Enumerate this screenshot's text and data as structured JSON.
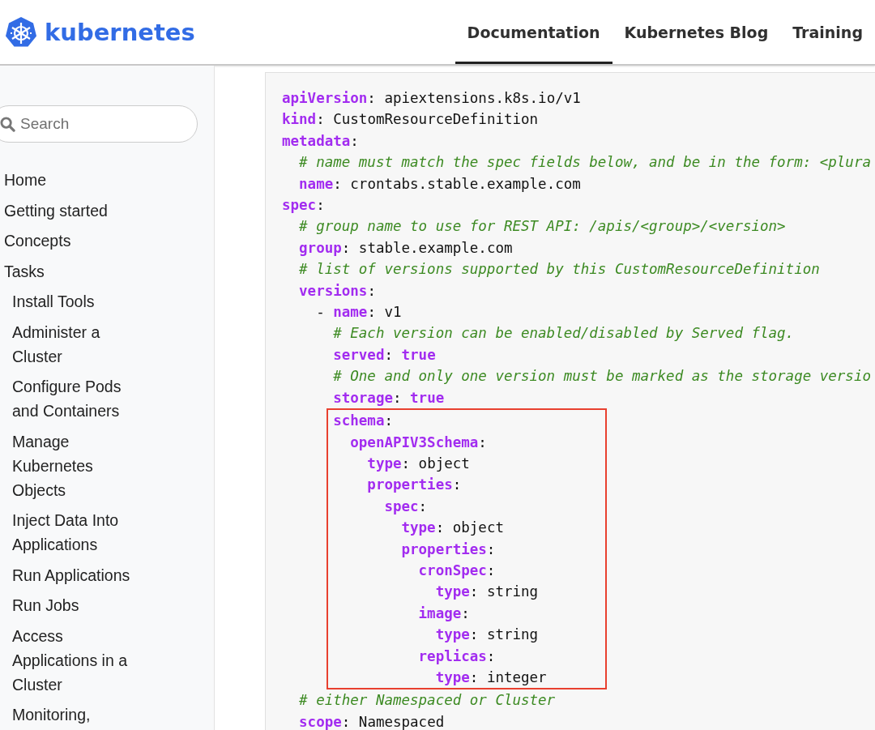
{
  "header": {
    "logo": "kubernetes",
    "nav": [
      {
        "label": "Documentation",
        "selected": true
      },
      {
        "label": "Kubernetes Blog",
        "selected": false
      },
      {
        "label": "Training",
        "selected": false
      }
    ]
  },
  "sidebar": {
    "search": {
      "placeholder": "Search"
    },
    "items": [
      {
        "label": "Home"
      },
      {
        "label": "Getting started"
      },
      {
        "label": "Concepts"
      },
      {
        "label": "Tasks",
        "children": [
          {
            "label": "Install Tools"
          },
          {
            "label": "Administer a Cluster"
          },
          {
            "label": "Configure Pods and Containers"
          },
          {
            "label": "Manage Kubernetes Objects"
          },
          {
            "label": "Inject Data Into Applications"
          },
          {
            "label": "Run Applications"
          },
          {
            "label": "Run Jobs"
          },
          {
            "label": "Access Applications in a Cluster"
          },
          {
            "label": "Monitoring,"
          }
        ]
      }
    ]
  },
  "code": {
    "lines": [
      {
        "kind": "pair",
        "key": "apiVersion",
        "sep": ":",
        "value": "apiextensions.k8s.io/v1"
      },
      {
        "kind": "pair",
        "key": "kind",
        "sep": ":",
        "value": "CustomResourceDefinition"
      },
      {
        "kind": "pair",
        "key": "metadata",
        "sep": ":"
      },
      {
        "kind": "comment",
        "text": "  # name must match the spec fields below, and be in the form: <plura"
      },
      {
        "kind": "pair",
        "key": "  name",
        "sep": ":",
        "value": "crontabs.stable.example.com"
      },
      {
        "kind": "pair",
        "key": "spec",
        "sep": ":"
      },
      {
        "kind": "comment",
        "text": "  # group name to use for REST API: /apis/<group>/<version>"
      },
      {
        "kind": "pair",
        "key": "  group",
        "sep": ":",
        "value": "stable.example.com"
      },
      {
        "kind": "comment",
        "text": "  # list of versions supported by this CustomResourceDefinition"
      },
      {
        "kind": "pair",
        "key": "  versions",
        "sep": ":"
      },
      {
        "kind": "item",
        "dash": "    - ",
        "key": "name",
        "sep": ":",
        "value": "v1"
      },
      {
        "kind": "comment",
        "text": "      # Each version can be enabled/disabled by Served flag."
      },
      {
        "kind": "pair",
        "key": "      served",
        "sep": ":",
        "value": "true",
        "literal": true
      },
      {
        "kind": "comment",
        "text": "      # One and only one version must be marked as the storage versio"
      },
      {
        "kind": "pair",
        "key": "      storage",
        "sep": ":",
        "value": "true",
        "literal": true
      },
      {
        "kind": "highlight",
        "lines": [
          {
            "kind": "pair",
            "key": "schema",
            "sep": ":"
          },
          {
            "kind": "pair",
            "key": "  openAPIV3Schema",
            "sep": ":"
          },
          {
            "kind": "pair",
            "key": "    type",
            "sep": ":",
            "value": "object"
          },
          {
            "kind": "pair",
            "key": "    properties",
            "sep": ":"
          },
          {
            "kind": "pair",
            "key": "      spec",
            "sep": ":"
          },
          {
            "kind": "pair",
            "key": "        type",
            "sep": ":",
            "value": "object"
          },
          {
            "kind": "pair",
            "key": "        properties",
            "sep": ":"
          },
          {
            "kind": "pair",
            "key": "          cronSpec",
            "sep": ":"
          },
          {
            "kind": "pair",
            "key": "            type",
            "sep": ":",
            "value": "string"
          },
          {
            "kind": "pair",
            "key": "          image",
            "sep": ":"
          },
          {
            "kind": "pair",
            "key": "            type",
            "sep": ":",
            "value": "string"
          },
          {
            "kind": "pair",
            "key": "          replicas",
            "sep": ":"
          },
          {
            "kind": "pair",
            "key": "            type",
            "sep": ":",
            "value": "integer"
          }
        ]
      },
      {
        "kind": "comment",
        "text": "  # either Namespaced or Cluster"
      },
      {
        "kind": "pair",
        "key": "  scope",
        "sep": ":",
        "value": "Namespaced"
      }
    ]
  }
}
